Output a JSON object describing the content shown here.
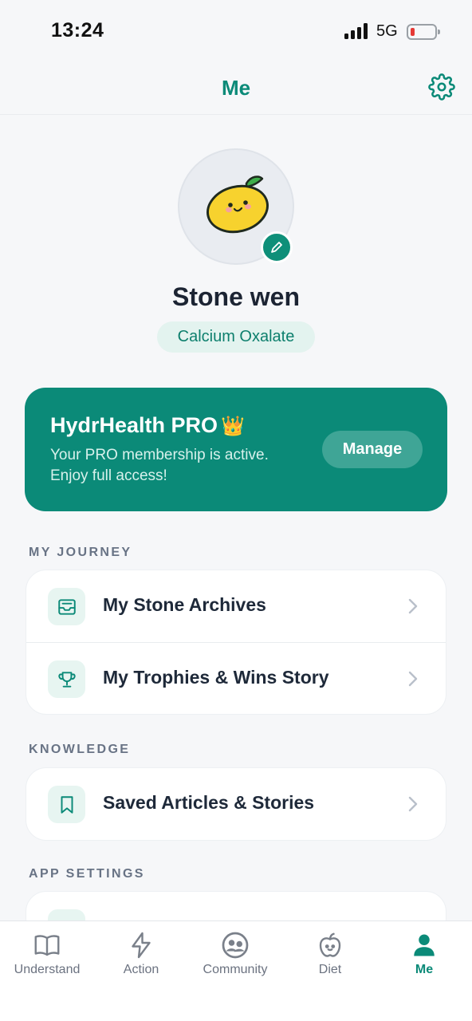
{
  "status_bar": {
    "time": "13:24",
    "network": "5G"
  },
  "header": {
    "title": "Me",
    "settings_icon": "gear-icon"
  },
  "profile": {
    "name": "Stone wen",
    "stone_type": "Calcium Oxalate",
    "avatar_icon": "lemon-mascot-icon"
  },
  "pro_card": {
    "title": "HydrHealth PRO",
    "crown": "👑",
    "description": "Your PRO membership is active. Enjoy full access!",
    "manage_label": "Manage"
  },
  "sections": {
    "journey": {
      "title": "MY JOURNEY",
      "items": [
        {
          "label": "My Stone Archives",
          "icon": "archive-tray-icon"
        },
        {
          "label": "My Trophies & Wins Story",
          "icon": "trophy-icon"
        }
      ]
    },
    "knowledge": {
      "title": "KNOWLEDGE",
      "items": [
        {
          "label": "Saved Articles & Stories",
          "icon": "bookmark-icon"
        }
      ]
    },
    "app_settings": {
      "title": "APP SETTINGS"
    }
  },
  "tabs": [
    {
      "label": "Understand",
      "icon": "book-icon"
    },
    {
      "label": "Action",
      "icon": "lightning-icon"
    },
    {
      "label": "Community",
      "icon": "community-icon"
    },
    {
      "label": "Diet",
      "icon": "apple-icon"
    },
    {
      "label": "Me",
      "icon": "person-icon",
      "active": true
    }
  ],
  "colors": {
    "brand": "#0b8a78",
    "background": "#f6f7f9"
  }
}
